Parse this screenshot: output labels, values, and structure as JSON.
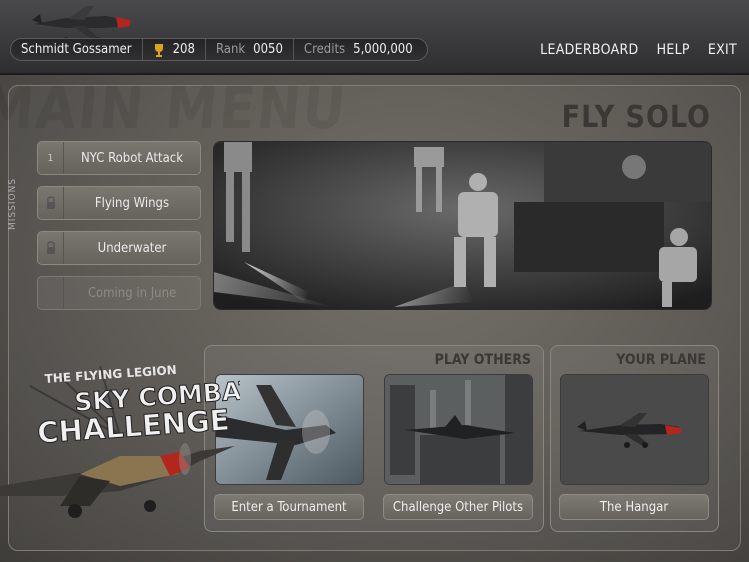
{
  "player": {
    "name": "Schmidt Gossamer",
    "trophies": "208",
    "rank_label": "Rank",
    "rank": "0050",
    "credits_label": "Credits",
    "credits": "5,000,000"
  },
  "nav": {
    "leaderboard": "LEADERBOARD",
    "help": "HELP",
    "exit": "EXIT"
  },
  "page": {
    "bg_title": "MAIN MENU",
    "section_title": "FLY SOLO",
    "missions_label": "MISSIONS"
  },
  "missions": [
    {
      "label": "NYC Robot Attack",
      "icon": "mission-1",
      "slot_text": "1"
    },
    {
      "label": "Flying Wings",
      "icon": "lock-icon"
    },
    {
      "label": "Underwater",
      "icon": "lock-icon"
    },
    {
      "label": "Coming in June",
      "icon": ""
    }
  ],
  "play_others": {
    "title": "PLAY OTHERS",
    "tournament_label": "Enter a Tournament",
    "challenge_label": "Challenge Other Pilots"
  },
  "your_plane": {
    "title": "YOUR PLANE",
    "hangar_label": "The Hangar"
  },
  "brand": {
    "line1": "THE FLYING LEGION",
    "line2": "SKY COMBAT",
    "line3": "CHALLENGE"
  },
  "colors": {
    "accent_red": "#b3261e",
    "trophy_gold": "#d9a520"
  }
}
